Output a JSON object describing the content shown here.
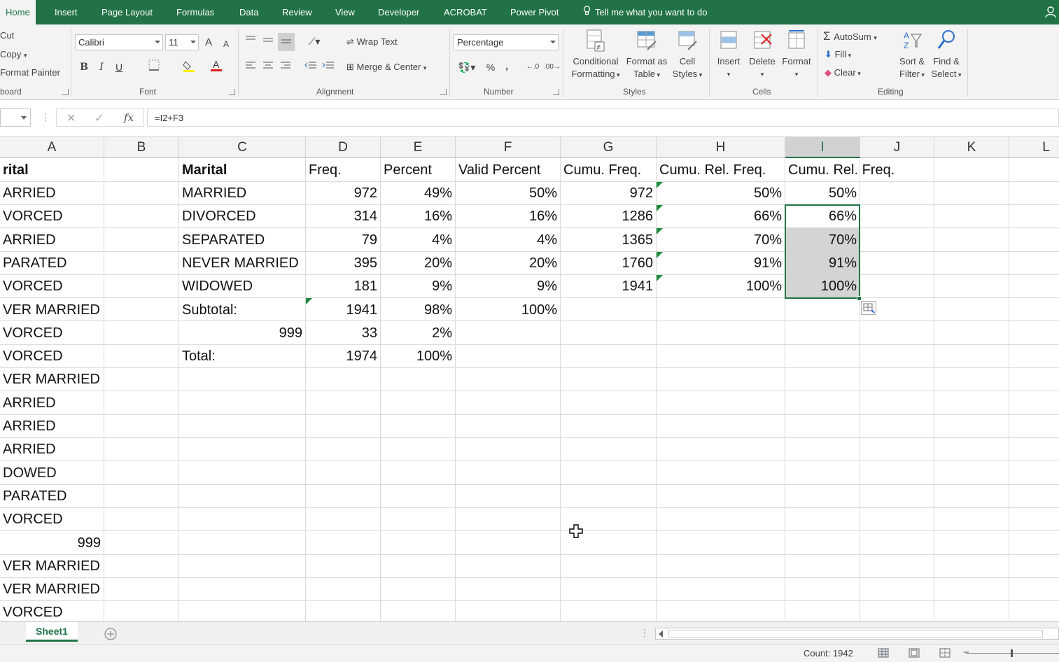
{
  "ribbon_tabs": [
    "Home",
    "Insert",
    "Page Layout",
    "Formulas",
    "Data",
    "Review",
    "View",
    "Developer",
    "ACROBAT",
    "Power Pivot"
  ],
  "tell_me": "Tell me what you want to do",
  "clipboard": {
    "cut": "Cut",
    "copy": "Copy",
    "format_painter": "Format Painter",
    "group": "board"
  },
  "font": {
    "name": "Calibri",
    "size": "11",
    "group": "Font",
    "bold": "B",
    "italic": "I",
    "underline": "U",
    "grow": "A",
    "shrink": "A"
  },
  "alignment": {
    "wrap_text": "Wrap Text",
    "merge_center": "Merge & Center",
    "group": "Alignment"
  },
  "number": {
    "format": "Percentage",
    "percent": "%",
    "comma": ",",
    "group": "Number"
  },
  "styles": {
    "conditional_1": "Conditional",
    "conditional_2": "Formatting",
    "format_as_1": "Format as",
    "format_as_2": "Table",
    "cell_styles_1": "Cell",
    "cell_styles_2": "Styles",
    "group": "Styles"
  },
  "cells": {
    "insert": "Insert",
    "delete": "Delete",
    "format": "Format",
    "group": "Cells"
  },
  "editing": {
    "autosum": "AutoSum",
    "fill": "Fill",
    "clear": "Clear",
    "sort_1": "Sort &",
    "sort_2": "Filter",
    "find_1": "Find &",
    "find_2": "Select",
    "group": "Editing"
  },
  "formula_bar": {
    "fx": "fx",
    "formula": "=I2+F3"
  },
  "columns": [
    "A",
    "B",
    "C",
    "D",
    "E",
    "F",
    "G",
    "H",
    "I",
    "J",
    "K",
    "L"
  ],
  "col_a": [
    "rital",
    "ARRIED",
    "VORCED",
    "ARRIED",
    "PARATED",
    "VORCED",
    "VER MARRIED",
    "VORCED",
    "VORCED",
    "VER MARRIED",
    "ARRIED",
    "ARRIED",
    "ARRIED",
    "DOWED",
    "PARATED",
    "VORCED",
    "999",
    "VER MARRIED",
    "VER MARRIED",
    "VORCED"
  ],
  "table": {
    "headers": [
      "Marital",
      "Freq.",
      "Percent",
      "Valid Percent",
      "Cumu. Freq.",
      "Cumu. Rel. Freq.",
      "Cumu. Rel. Freq."
    ],
    "rows": [
      [
        "MARRIED",
        "972",
        "49%",
        "50%",
        "972",
        "50%",
        "50%"
      ],
      [
        "DIVORCED",
        "314",
        "16%",
        "16%",
        "1286",
        "66%",
        "66%"
      ],
      [
        "SEPARATED",
        "79",
        "4%",
        "4%",
        "1365",
        "70%",
        "70%"
      ],
      [
        "NEVER MARRIED",
        "395",
        "20%",
        "20%",
        "1760",
        "91%",
        "91%"
      ],
      [
        "WIDOWED",
        "181",
        "9%",
        "9%",
        "1941",
        "100%",
        "100%"
      ]
    ],
    "subtotal": [
      "Subtotal:",
      "1941",
      "98%",
      "100%"
    ],
    "missing": [
      "999",
      "33",
      "2%"
    ],
    "total": [
      "Total:",
      "1974",
      "100%"
    ]
  },
  "sheet_tab": "Sheet1",
  "status": {
    "count": "Count: 1942"
  },
  "colors": {
    "accent": "#217346",
    "selection": "#d4d4d4",
    "error_triangle": "#1e8a3a"
  }
}
